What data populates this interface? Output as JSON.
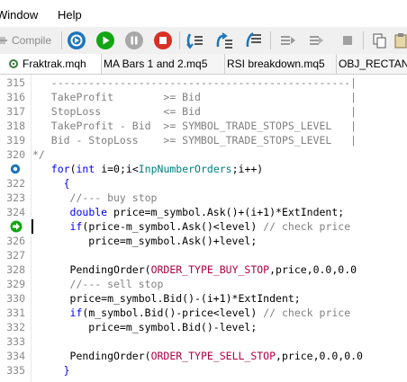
{
  "menu": {
    "window": "Window",
    "help": "Help"
  },
  "toolbar": {
    "compile_label": "Compile"
  },
  "tabs": [
    {
      "label": "Fraktrak.mqh",
      "active": true
    },
    {
      "label": "MA Bars 1 and 2.mq5"
    },
    {
      "label": "RSI breakdown.mq5"
    },
    {
      "label": "OBJ_RECTAN"
    }
  ],
  "colors": {
    "run_green": "#12a612",
    "stop_red": "#d93025",
    "debug_blue": "#1c75bc",
    "breakpoint_blue": "#1c75bc",
    "keyword_blue": "#0000ff",
    "macro_red": "#b00040",
    "comment_gray": "#808080",
    "input_teal": "#008080"
  },
  "editor": {
    "lines": [
      {
        "num": "315",
        "segs": [
          [
            "cmt",
            "   ------------------------------------------------|"
          ]
        ]
      },
      {
        "num": "316",
        "segs": [
          [
            "cmt",
            "   TakeProfit        >= Bid                        |"
          ]
        ]
      },
      {
        "num": "317",
        "segs": [
          [
            "cmt",
            "   StopLoss          <= Bid                        |"
          ]
        ]
      },
      {
        "num": "318",
        "segs": [
          [
            "cmt",
            "   TakeProfit - Bid  >= SYMBOL_TRADE_STOPS_LEVEL   |"
          ]
        ]
      },
      {
        "num": "319",
        "segs": [
          [
            "cmt",
            "   Bid - StopLoss    >= SYMBOL_TRADE_STOPS_LEVEL   |"
          ]
        ]
      },
      {
        "num": "320",
        "segs": [
          [
            "cmt",
            "*/"
          ]
        ]
      },
      {
        "num": "321",
        "icon": "breakpoint",
        "segs": [
          [
            "",
            "   "
          ],
          [
            "kw",
            "for"
          ],
          [
            "",
            "("
          ],
          [
            "kw",
            "int"
          ],
          [
            "",
            " i=0;i<"
          ],
          [
            "inp",
            "InpNumberOrders"
          ],
          [
            "",
            ";i++)"
          ]
        ]
      },
      {
        "num": "322",
        "segs": [
          [
            "",
            "     "
          ],
          [
            "kw",
            "{"
          ]
        ]
      },
      {
        "num": "323",
        "segs": [
          [
            "",
            "      "
          ],
          [
            "cmt",
            "//--- buy stop"
          ]
        ]
      },
      {
        "num": "324",
        "segs": [
          [
            "",
            "      "
          ],
          [
            "kw",
            "double"
          ],
          [
            "",
            " price=m_symbol.Ask()+(i+1)*ExtIndent;"
          ]
        ]
      },
      {
        "num": "325",
        "icon": "current",
        "segs": [
          [
            "",
            "      "
          ],
          [
            "kw",
            "if"
          ],
          [
            "",
            "(price-m_symbol.Ask()<level) "
          ],
          [
            "cmt",
            "// check price"
          ]
        ]
      },
      {
        "num": "326",
        "segs": [
          [
            "",
            "         price=m_symbol.Ask()+level;"
          ]
        ]
      },
      {
        "num": "327",
        "segs": [
          [
            "",
            ""
          ]
        ]
      },
      {
        "num": "328",
        "segs": [
          [
            "",
            "      PendingOrder("
          ],
          [
            "mac",
            "ORDER_TYPE_BUY_STOP"
          ],
          [
            "",
            ",price,0.0,0.0"
          ]
        ]
      },
      {
        "num": "329",
        "segs": [
          [
            "",
            "      "
          ],
          [
            "cmt",
            "//--- sell stop"
          ]
        ]
      },
      {
        "num": "330",
        "segs": [
          [
            "",
            "      price=m_symbol.Bid()-(i+1)*ExtIndent;"
          ]
        ]
      },
      {
        "num": "331",
        "segs": [
          [
            "",
            "      "
          ],
          [
            "kw",
            "if"
          ],
          [
            "",
            "(m_symbol.Bid()-price<level) "
          ],
          [
            "cmt",
            "// check price"
          ]
        ]
      },
      {
        "num": "332",
        "segs": [
          [
            "",
            "         price=m_symbol.Bid()-level;"
          ]
        ]
      },
      {
        "num": "333",
        "segs": [
          [
            "",
            ""
          ]
        ]
      },
      {
        "num": "334",
        "segs": [
          [
            "",
            "      PendingOrder("
          ],
          [
            "mac",
            "ORDER_TYPE_SELL_STOP"
          ],
          [
            "",
            ",price,0.0,0.0"
          ]
        ]
      },
      {
        "num": "335",
        "segs": [
          [
            "",
            "     "
          ],
          [
            "kw",
            "}"
          ]
        ]
      }
    ]
  }
}
